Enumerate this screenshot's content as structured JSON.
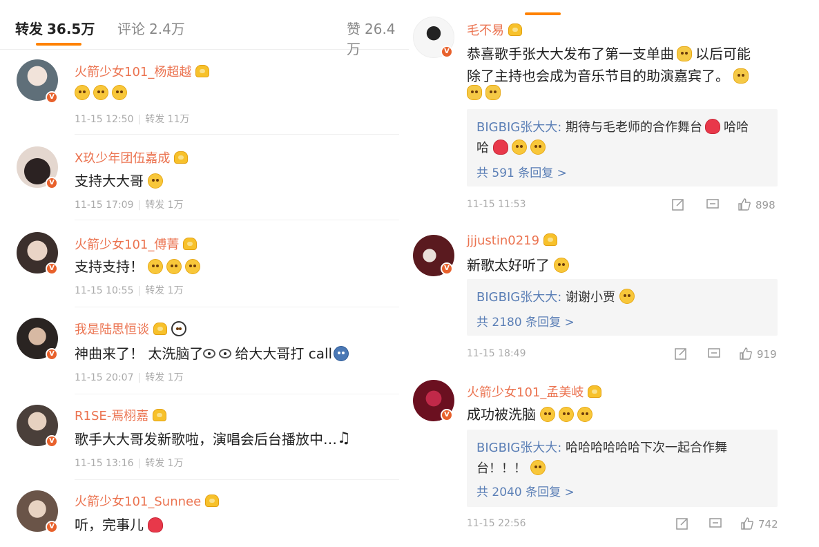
{
  "header": {
    "tabs": [
      {
        "label": "转发",
        "count": "36.5万"
      },
      {
        "label": "评论",
        "count": "2.4万"
      },
      {
        "label": "赞",
        "count": "26.4万"
      }
    ]
  },
  "reposts": [
    {
      "name": "火箭少女101_杨超越",
      "text": "",
      "emojis": [
        "grin-sweat",
        "grin-sweat",
        "grin-sweat"
      ],
      "time": "11-15 12:50",
      "repost_label": "转发",
      "repost_count": "11万",
      "avatar_color": "#5f6f79"
    },
    {
      "name": "X玖少年团伍嘉成",
      "text": "支持大大哥",
      "emojis": [
        "grin"
      ],
      "time": "11-15 17:09",
      "repost_label": "转发",
      "repost_count": "1万",
      "avatar_color": "#1f1a1a"
    },
    {
      "name": "火箭少女101_傅菁",
      "text": "支持支持！",
      "emojis": [
        "grin-sweat",
        "grin-sweat",
        "grin-sweat"
      ],
      "time": "11-15 10:55",
      "repost_label": "转发",
      "repost_count": "1万",
      "avatar_color": "#3b2f2c"
    },
    {
      "name": "我是陆思恒谈",
      "text": "神曲来了！ 太洗脑了",
      "text2": "给大大哥打 call",
      "emojis": [],
      "time": "11-15 20:07",
      "repost_label": "转发",
      "repost_count": "1万",
      "avatar_color": "#2a2422"
    },
    {
      "name": "R1SE-焉栩嘉",
      "text": "歌手大大哥发新歌啦，演唱会后台播放中…",
      "emojis": [
        "note"
      ],
      "time": "11-15 13:16",
      "repost_label": "转发",
      "repost_count": "1万",
      "avatar_color": "#4a3f3a"
    },
    {
      "name": "火箭少女101_Sunnee",
      "text": "听，完事儿",
      "emojis": [
        "heart-eyes"
      ],
      "time": "",
      "repost_label": "转发",
      "repost_count": "",
      "avatar_color": "#6a5448"
    }
  ],
  "comments": [
    {
      "name": "毛不易",
      "text_line1": "恭喜歌手张大大发布了第一支单曲",
      "text_line1b": "以后可能",
      "text_line2": "除了主持也会成为音乐节目的助演嘉宾了。",
      "reply_author": "BIGBIG张大大:",
      "reply_text": "期待与毛老师的合作舞台",
      "reply_text_after": "哈哈",
      "reply_text2": "哈",
      "reply_total": "共 591 条回复 >",
      "time": "11-15 11:53",
      "likes": "898",
      "avatar_color": "#ffffff"
    },
    {
      "name": "jjjustin0219",
      "text_line1": "新歌太好听了",
      "reply_author": "BIGBIG张大大:",
      "reply_text": "谢谢小贾",
      "reply_total": "共 2180 条回复 >",
      "time": "11-15 18:49",
      "likes": "919",
      "avatar_color": "#5a1a1f"
    },
    {
      "name": "火箭少女101_孟美岐",
      "text_line1": "成功被洗脑",
      "reply_author": "BIGBIG张大大:",
      "reply_text": "哈哈哈哈哈哈下次一起合作舞",
      "reply_text2": "台！！！",
      "reply_total": "共 2040 条回复 >",
      "time": "11-15 22:56",
      "likes": "742",
      "avatar_color": "#6b1020"
    }
  ],
  "badge_label": "V",
  "colors": {
    "accent": "#ff8200",
    "name": "#eb7350",
    "link": "#5b7fb6",
    "vbadge": "#e8612c"
  }
}
